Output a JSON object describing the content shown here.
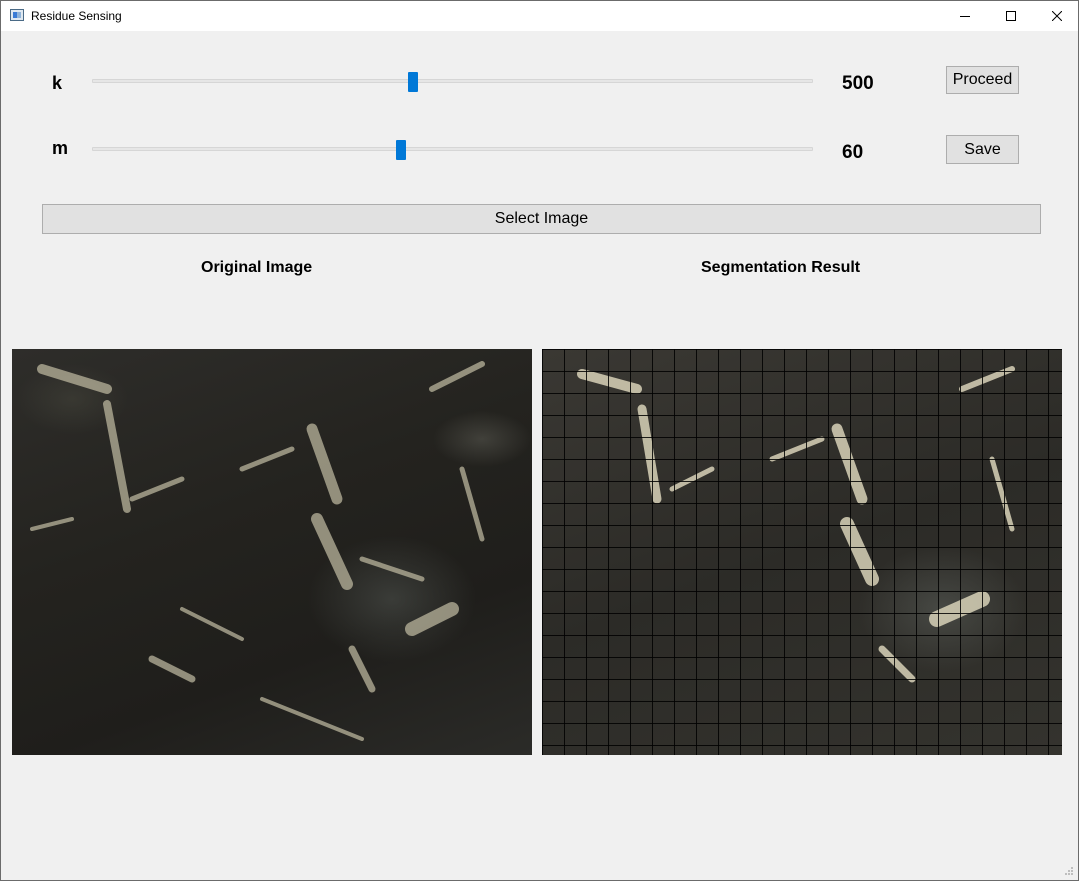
{
  "window": {
    "title": "Residue Sensing"
  },
  "sliders": [
    {
      "label": "k",
      "value": "500",
      "fraction": 0.445
    },
    {
      "label": "m",
      "value": "60",
      "fraction": 0.428
    }
  ],
  "buttons": {
    "proceed": "Proceed",
    "save": "Save",
    "select_image": "Select Image"
  },
  "panels": {
    "original_heading": "Original Image",
    "segmentation_heading": "Segmentation Result"
  },
  "colors": {
    "accent": "#0078d7",
    "background": "#f0f0f0",
    "button": "#e1e1e1"
  },
  "icons": [
    "app-icon",
    "minimize-icon",
    "maximize-icon",
    "close-icon",
    "resize-grip-icon"
  ]
}
